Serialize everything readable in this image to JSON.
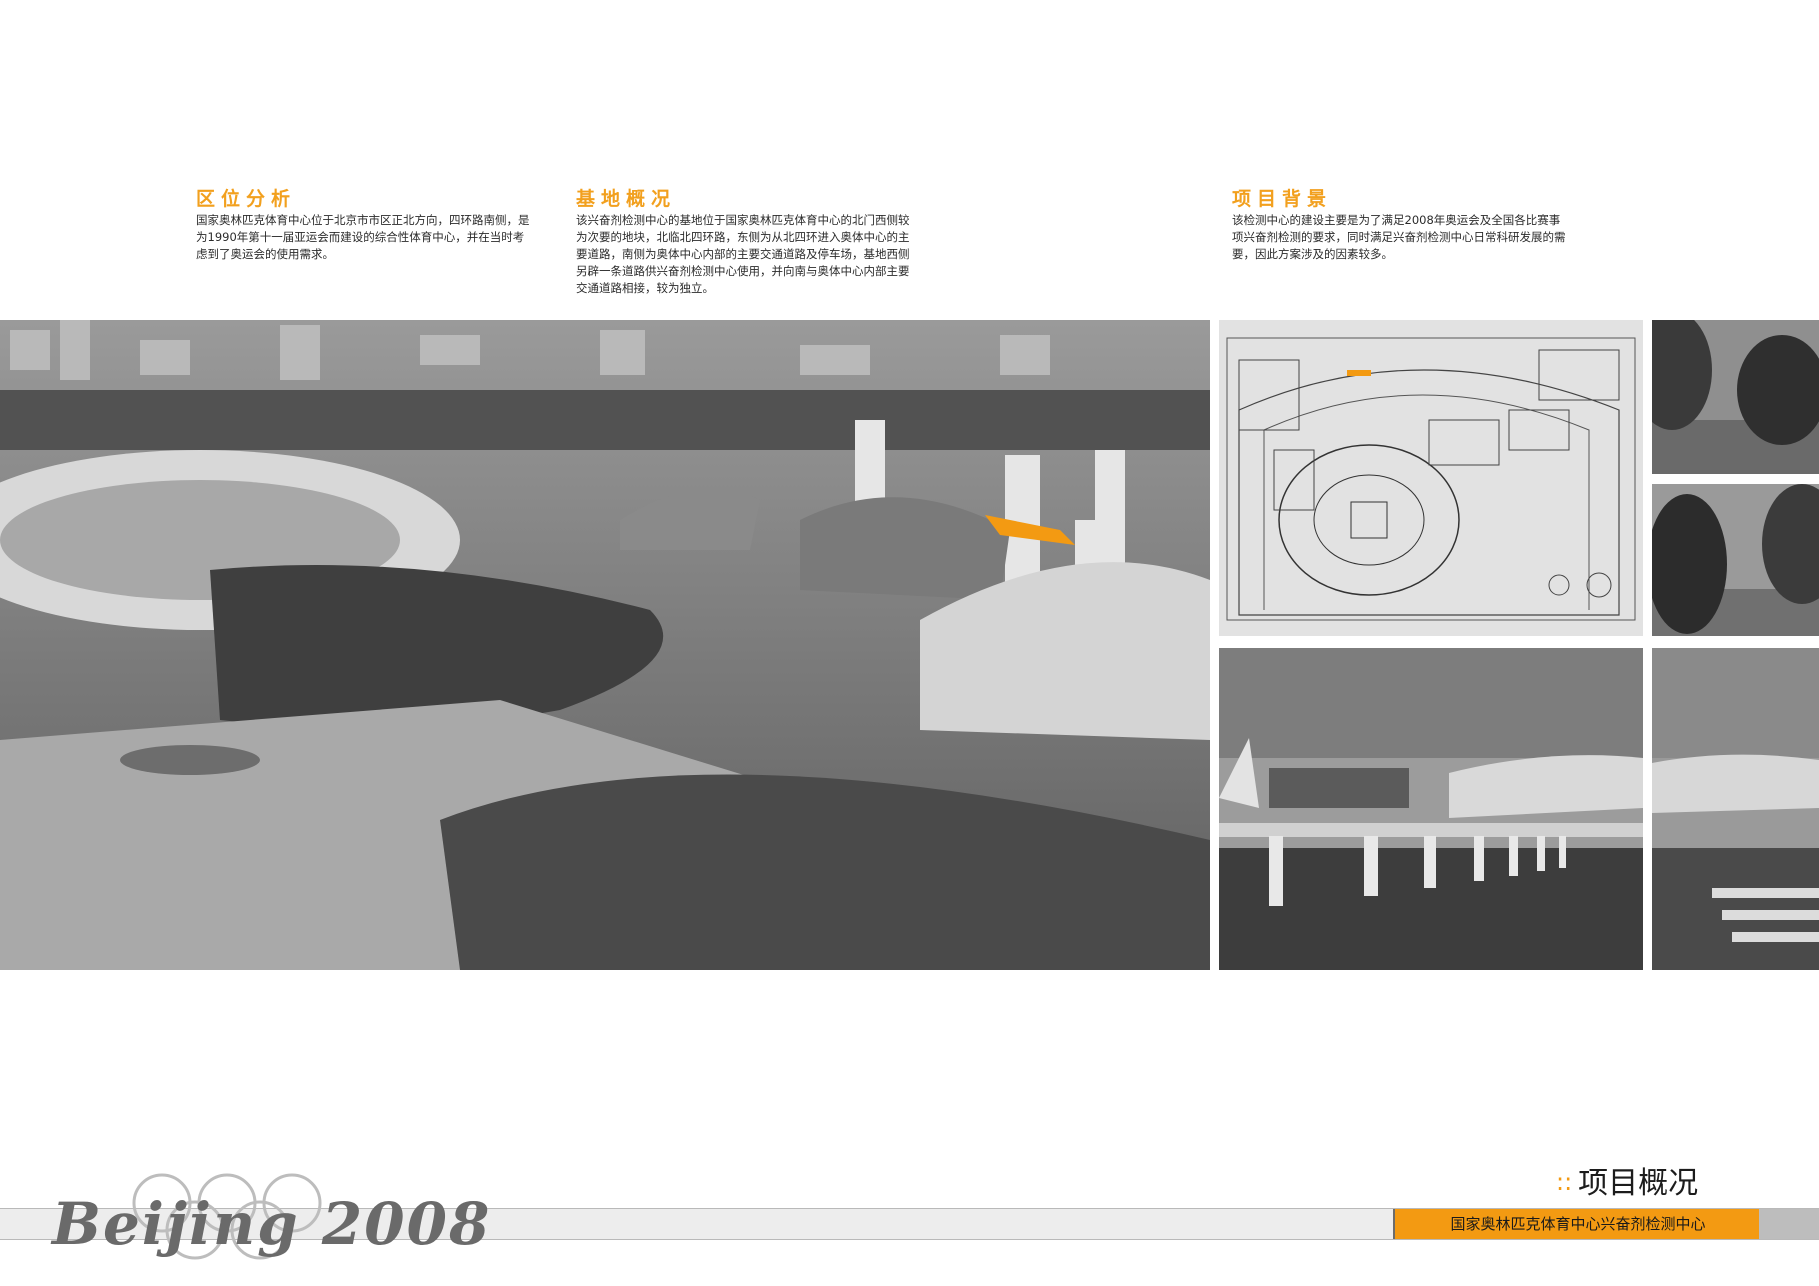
{
  "sections": [
    {
      "title": "区位分析",
      "body": "国家奥林匹克体育中心位于北京市市区正北方向，四环路南侧，是为1990年第十一届亚运会而建设的综合性体育中心，并在当时考虑到了奥运会的使用需求。"
    },
    {
      "title": "基地概况",
      "body": "该兴奋剂检测中心的基地位于国家奥林匹克体育中心的北门西侧较为次要的地块，北临北四环路，东侧为从北四环进入奥体中心的主要道路，南侧为奥体中心内部的主要交通道路及停车场，基地西侧另辟一条道路供兴奋剂检测中心使用，并向南与奥体中心内部主要交通道路相接，较为独立。"
    },
    {
      "title": "项目背景",
      "body": "该检测中心的建设主要是为了满足2008年奥运会及全国各比赛事项兴奋剂检测的要求，同时满足兴奋剂检测中心日常科研发展的需要，因此方案涉及的因素较多。"
    }
  ],
  "page_heading": {
    "dots": "::",
    "title": "项目概况"
  },
  "footer": {
    "project_name": "国家奥林匹克体育中心兴奋剂检测中心"
  },
  "logo": {
    "text": "Beijing 2008"
  },
  "colors": {
    "accent": "#f39a12",
    "title": "#f2a01e",
    "photo_gray": "#6f6f6f"
  }
}
